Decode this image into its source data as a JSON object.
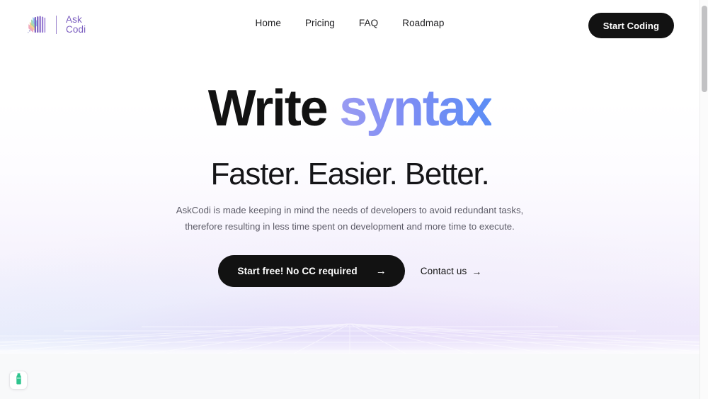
{
  "brand": {
    "line1": "Ask",
    "line2": "Codi",
    "mark": "stacked-cards-logo-icon",
    "color": "#7c5fc0"
  },
  "header": {
    "nav": [
      {
        "label": "Home",
        "name": "nav-link-home"
      },
      {
        "label": "Pricing",
        "name": "nav-link-pricing"
      },
      {
        "label": "FAQ",
        "name": "nav-link-faq"
      },
      {
        "label": "Roadmap",
        "name": "nav-link-roadmap"
      }
    ],
    "cta_label": "Start Coding",
    "cta_bg": "#121212"
  },
  "hero": {
    "headline_dark": "Write",
    "headline_accent": "syntax",
    "headline_accent_gradient_from": "#9a9bf2",
    "headline_accent_gradient_to": "#5c8df5",
    "subheadline": "Faster. Easier. Better.",
    "lede_line1": "AskCodi is made keeping in mind the needs of developers to avoid redundant tasks,",
    "lede_line2": "therefore resulting in less time spent on development and more time to execute.",
    "primary_cta_label": "Start free! No CC required",
    "primary_cta_arrow": "→",
    "secondary_cta_label": "Contact us",
    "secondary_cta_arrow": "→"
  },
  "floating_badge": {
    "icon": "green-bottle-icon",
    "color": "#2ec48e"
  },
  "scrollbar": {
    "thumb_color": "#c2c2c4"
  }
}
